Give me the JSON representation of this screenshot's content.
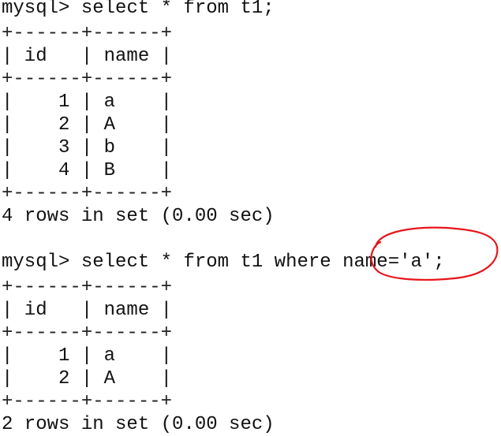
{
  "terminal": {
    "query1": {
      "prompt": "mysql>",
      "command": "select * from t1;",
      "border": "+------+------+",
      "header": "| id   | name |",
      "rows": [
        "|    1 | a    |",
        "|    2 | A    |",
        "|    3 | b    |",
        "|    4 | B    |"
      ],
      "result": "4 rows in set (0.00 sec)"
    },
    "query2": {
      "prompt": "mysql>",
      "command": "select * from t1 where name='a';",
      "border": "+------+------+",
      "header": "| id   | name |",
      "rows": [
        "|    1 | a    |",
        "|    2 | A    |"
      ],
      "result": "2 rows in set (0.00 sec)"
    }
  },
  "annotation": {
    "color": "#e8141b",
    "circled_text": "name='a';"
  }
}
